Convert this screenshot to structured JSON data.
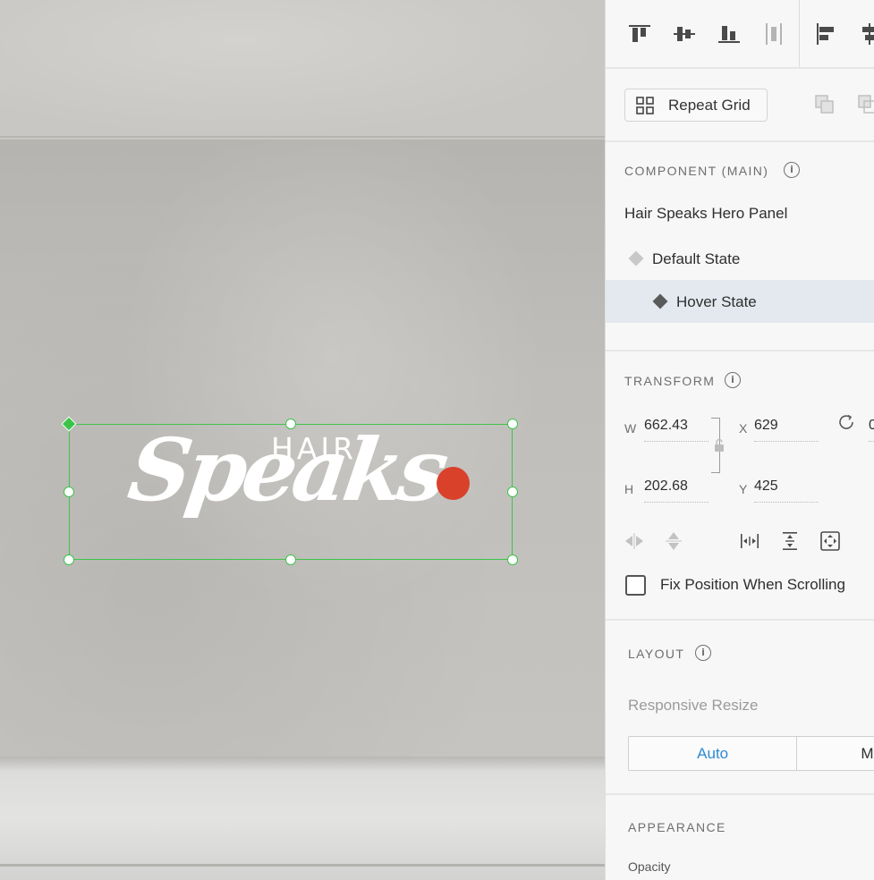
{
  "canvas": {
    "logo": {
      "top_word": "HAIR",
      "main_word": "Speaks"
    },
    "colors": {
      "selection": "#3cc44a",
      "accent_dot": "#d9412a"
    }
  },
  "toolbar": {
    "icons": [
      "align-top-icon",
      "align-middle-icon",
      "align-bottom-icon",
      "distribute-vertical-icon",
      "align-left-icon",
      "align-center-icon"
    ]
  },
  "repeat_grid": {
    "label": "Repeat Grid"
  },
  "component": {
    "title": "COMPONENT (MAIN)",
    "name": "Hair Speaks Hero Panel",
    "states": [
      {
        "label": "Default State",
        "active": false
      },
      {
        "label": "Hover State",
        "active": true
      }
    ]
  },
  "transform": {
    "title": "TRANSFORM",
    "w_label": "W",
    "w_value": "662.43",
    "h_label": "H",
    "h_value": "202.68",
    "x_label": "X",
    "x_value": "629",
    "y_label": "Y",
    "y_value": "425",
    "rotation_value": "0",
    "fix_position_label": "Fix Position When Scrolling",
    "fix_position_checked": false
  },
  "layout": {
    "title": "LAYOUT",
    "responsive_resize_label": "Responsive Resize",
    "options": [
      "Auto",
      "Manual"
    ],
    "options_visible": [
      "Auto",
      "Ma"
    ],
    "selected": "Auto"
  },
  "appearance": {
    "title": "APPEARANCE",
    "opacity_label": "Opacity"
  }
}
